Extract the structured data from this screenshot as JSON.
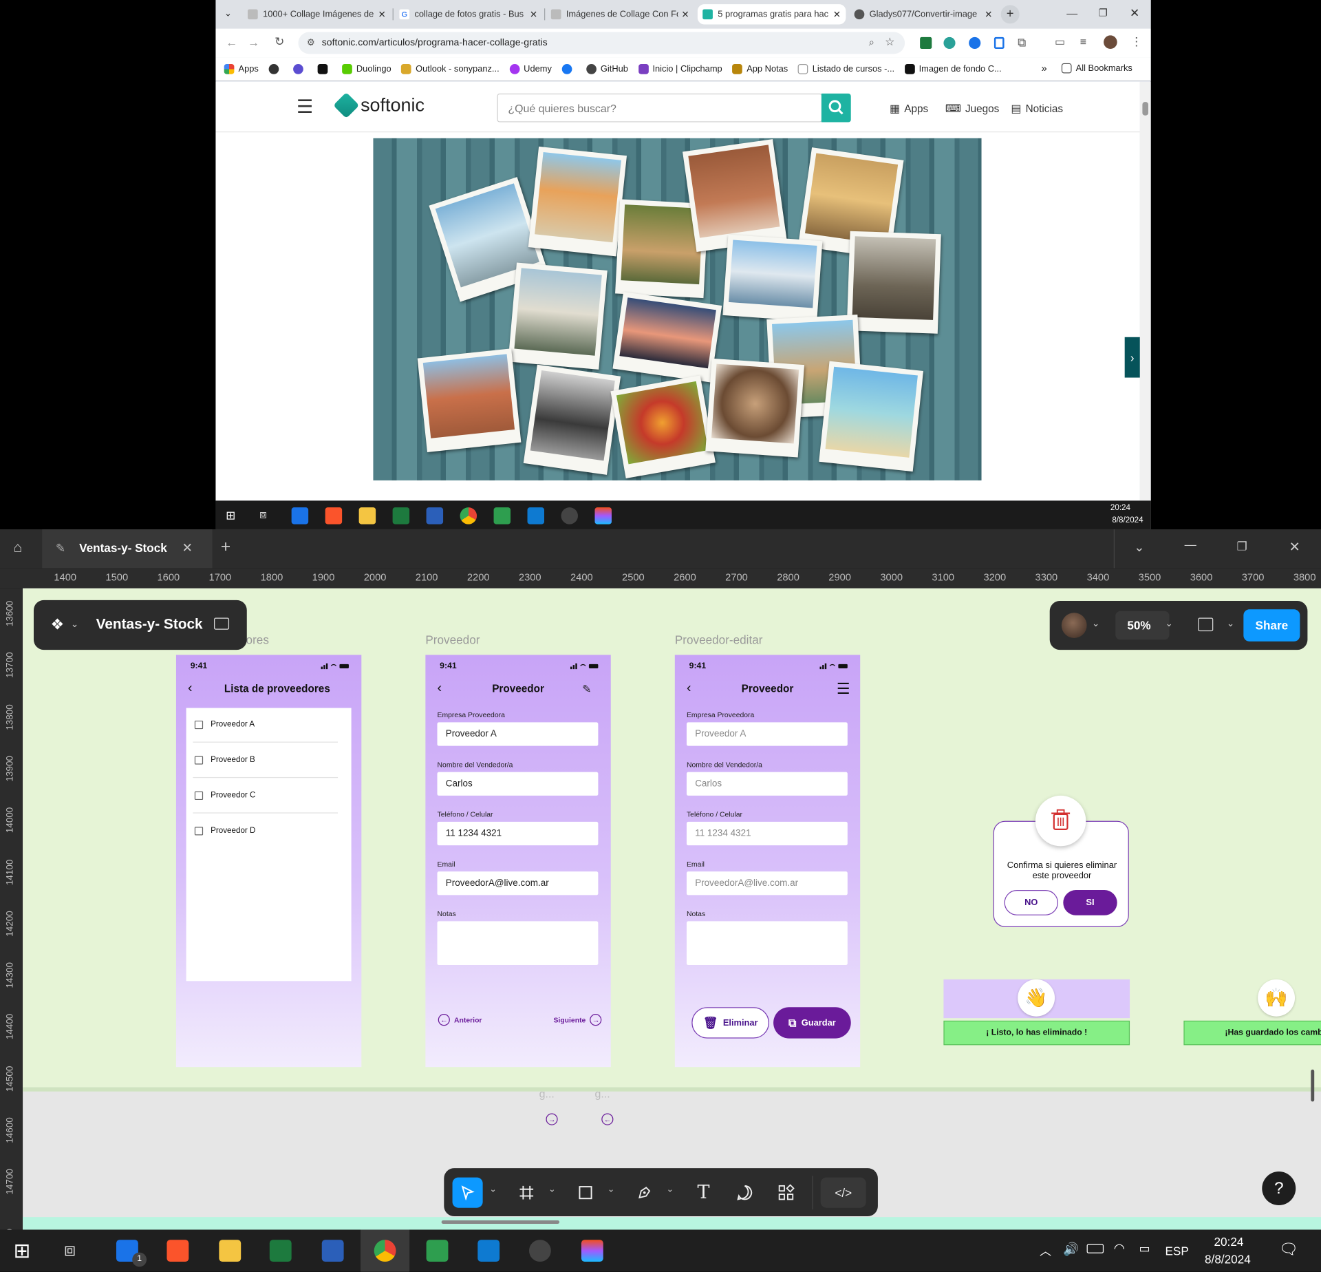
{
  "browser": {
    "tabs": [
      "1000+ Collage Imágenes de",
      "collage de fotos gratis - Bus",
      "Imágenes de Collage Con Fo",
      "5 programas gratis para hac",
      "Gladys077/Convertir-image"
    ],
    "url": "softonic.com/articulos/programa-hacer-collage-gratis",
    "bookmarks": [
      "Apps",
      "Duolingo",
      "Outlook - sonypanz...",
      "Udemy",
      "GitHub",
      "Inicio | Clipchamp",
      "App Notas",
      "Listado de cursos -...",
      "Imagen de fondo C..."
    ],
    "all_bookmarks": "All Bookmarks",
    "overflow": "»"
  },
  "softonic": {
    "logo": "softonic",
    "search_placeholder": "¿Qué quieres buscar?",
    "nav": [
      "Apps",
      "Juegos",
      "Noticias"
    ]
  },
  "win_small": {
    "time": "20:24",
    "date": "8/8/2024"
  },
  "figma": {
    "file_tab": "Ventas-y- Stock",
    "file_name": "Ventas-y- Stock",
    "zoom": "50%",
    "share": "Share",
    "ruler_h": [
      "1400",
      "1500",
      "1600",
      "1700",
      "1800",
      "1900",
      "2000",
      "2100",
      "2200",
      "2300",
      "2400",
      "2500",
      "2600",
      "2700",
      "2800",
      "2900",
      "3000",
      "3100",
      "3200",
      "3300",
      "3400",
      "3500",
      "3600",
      "3700",
      "3800"
    ],
    "ruler_v": [
      "13600",
      "13700",
      "13800",
      "13900",
      "14000",
      "14100",
      "14200",
      "14300",
      "14400",
      "14500",
      "14600",
      "14700",
      "00"
    ],
    "frame_titles": [
      "ores",
      "Proveedor",
      "Proveedor-editar"
    ],
    "phone_time": "9:41",
    "list": {
      "title": "Lista de proveedores",
      "items": [
        "Proveedor A",
        "Proveedor B",
        "Proveedor C",
        "Proveedor D"
      ]
    },
    "form": {
      "title": "Proveedor",
      "labels": [
        "Empresa Proveedora",
        "Nombre del Vendedor/a",
        "Teléfono / Celular",
        "Email",
        "Notas"
      ],
      "values": [
        "Proveedor A",
        "Carlos",
        "11 1234 4321",
        "ProveedorA@live.com.ar",
        ""
      ],
      "prev": "Anterior",
      "next": "Siguiente"
    },
    "edit": {
      "title": "Proveedor",
      "delete": "Eliminar",
      "save": "Guardar"
    },
    "dialog": {
      "text": "Confirma si quieres eliminar este proveedor",
      "no": "NO",
      "yes": "SI"
    },
    "toasts": [
      "¡ Listo, lo has eliminado !",
      "¡Has guardado los cambios"
    ],
    "below": [
      "g...",
      "g..."
    ],
    "help": "?"
  },
  "taskbar": {
    "lang": "ESP",
    "time": "20:24",
    "date": "8/8/2024",
    "mail_badge": "1"
  },
  "colors": {
    "purple": "#6a1b9a",
    "lavender": "#c8a4f7",
    "figma_blue": "#0d99ff",
    "section": "#e6f4d6"
  }
}
